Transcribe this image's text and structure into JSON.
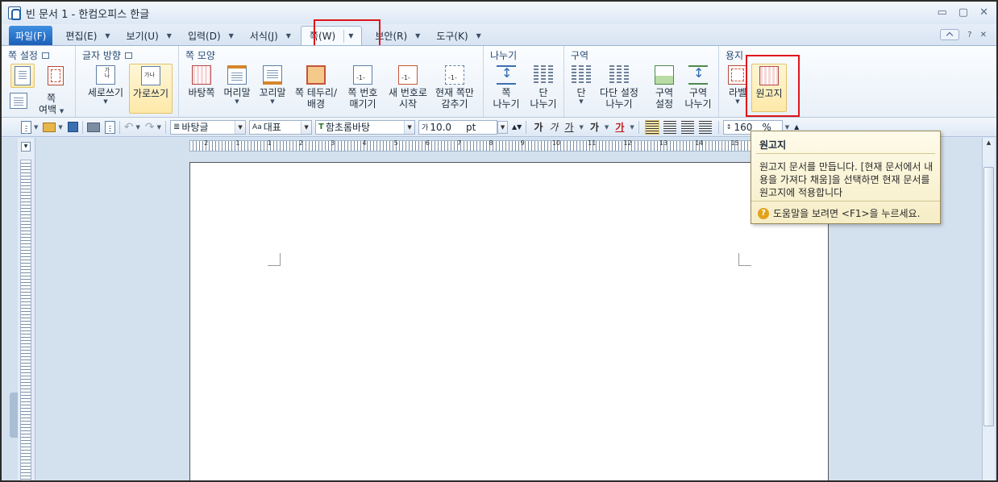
{
  "window": {
    "title": "빈 문서 1 - 한컴오피스 한글",
    "controls": [
      "▭",
      "▢",
      "✕"
    ]
  },
  "menu": {
    "file": "파일(F)",
    "items": [
      {
        "label": "편집(E)",
        "caret": "▼"
      },
      {
        "label": "보기(U)",
        "caret": "▼"
      },
      {
        "label": "입력(D)",
        "caret": "▼"
      },
      {
        "label": "서식(J)",
        "caret": "▼"
      },
      {
        "label": "쪽(W)",
        "caret": "▼"
      },
      {
        "label": "보안(R)",
        "caret": "▼"
      },
      {
        "label": "도구(K)",
        "caret": "▼"
      }
    ],
    "help": "?",
    "close": "✕"
  },
  "ribbon": {
    "groups": {
      "page_setup": "쪽 설정",
      "text_direction": "글자 방향",
      "page_shape": "쪽 모양",
      "split": "나누기",
      "section": "구역",
      "paper": "용지"
    },
    "buttons": {
      "page_margin_line1": "쪽",
      "page_margin_line2": "여백",
      "vertical": "세로쓰기",
      "horizontal": "가로쓰기",
      "background_page": "바탕쪽",
      "header": "머리말",
      "footer": "꼬리말",
      "border_line1": "쪽 테두리/",
      "border_line2": "배경",
      "page_number_line1": "쪽 번호",
      "page_number_line2": "매기기",
      "new_number_line1": "새 번호로",
      "new_number_line2": "시작",
      "hide_line1": "현재 쪽만",
      "hide_line2": "감추기",
      "page_break_line1": "쪽",
      "page_break_line2": "나누기",
      "column_break_line1": "단",
      "column_break_line2": "나누기",
      "column": "단",
      "multi_column_line1": "다단 설정",
      "multi_column_line2": "나누기",
      "section_setup_line1": "구역",
      "section_setup_line2": "설정",
      "section_split_line1": "구역",
      "section_split_line2": "나누기",
      "label": "라벨",
      "manuscript": "원고지"
    }
  },
  "toolbar": {
    "style": "바탕글",
    "language": "대표",
    "font": "함초롬바탕",
    "size": "10.0",
    "unit": "pt",
    "bold": "가",
    "italic": "가",
    "underline": "가",
    "strike": "가",
    "color": "가",
    "line_spacing": "160",
    "percent": "%"
  },
  "ruler": {
    "marks": [
      "2",
      "1",
      "1",
      "2",
      "3",
      "4",
      "5",
      "6",
      "7",
      "8",
      "9",
      "10",
      "11",
      "12",
      "13",
      "14",
      "15"
    ]
  },
  "tooltip": {
    "title": "원고지",
    "body": "원고지 문서를 만듭니다. [현재 문서에서 내용을 가져다 채움]을 선택하면 현재 문서를 원고지에 적용합니다",
    "help": "도움말을 보려면 <F1>을 누르세요."
  }
}
